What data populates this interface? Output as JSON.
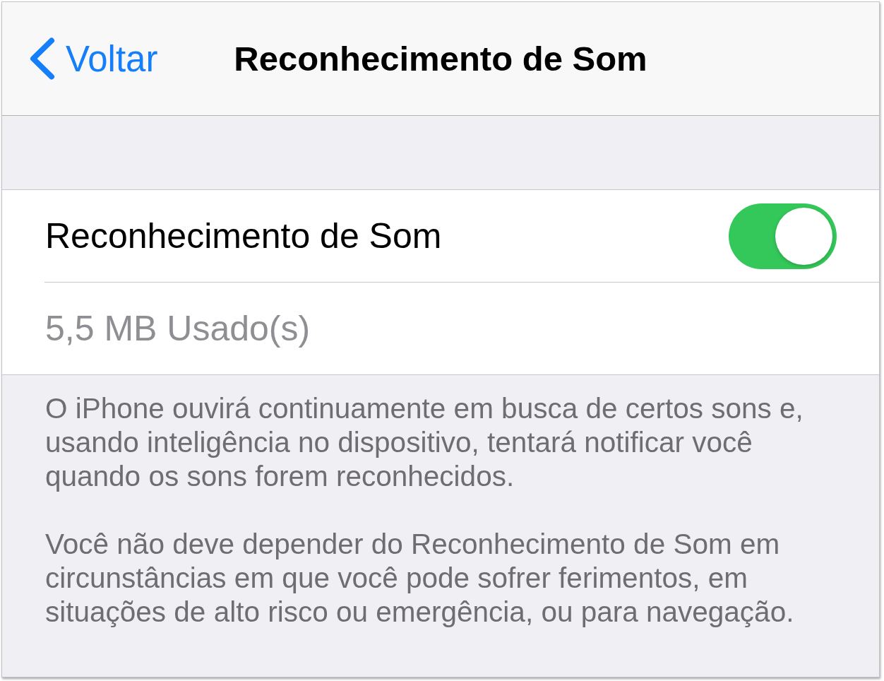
{
  "nav_bar": {
    "back_button": {
      "label": "Voltar"
    },
    "title": "Reconhecimento de Som"
  },
  "settings_group": {
    "rows": [
      {
        "kind": "toggle",
        "label": "Reconhecimento de Som",
        "on": true
      },
      {
        "kind": "info",
        "label": "5,5 MB Usado(s)"
      }
    ]
  },
  "footer": {
    "paragraphs": [
      "O iPhone ouvirá continuamente em busca de certos sons e, usando inteligência no dispositivo, tentará notificar você quando os sons forem reconhecidos.",
      "Você não deve depender do Reconhecimento de Som em circunstâncias em que você pode sofrer ferimentos, em situações de alto risco ou emergência, ou para navegação."
    ]
  }
}
